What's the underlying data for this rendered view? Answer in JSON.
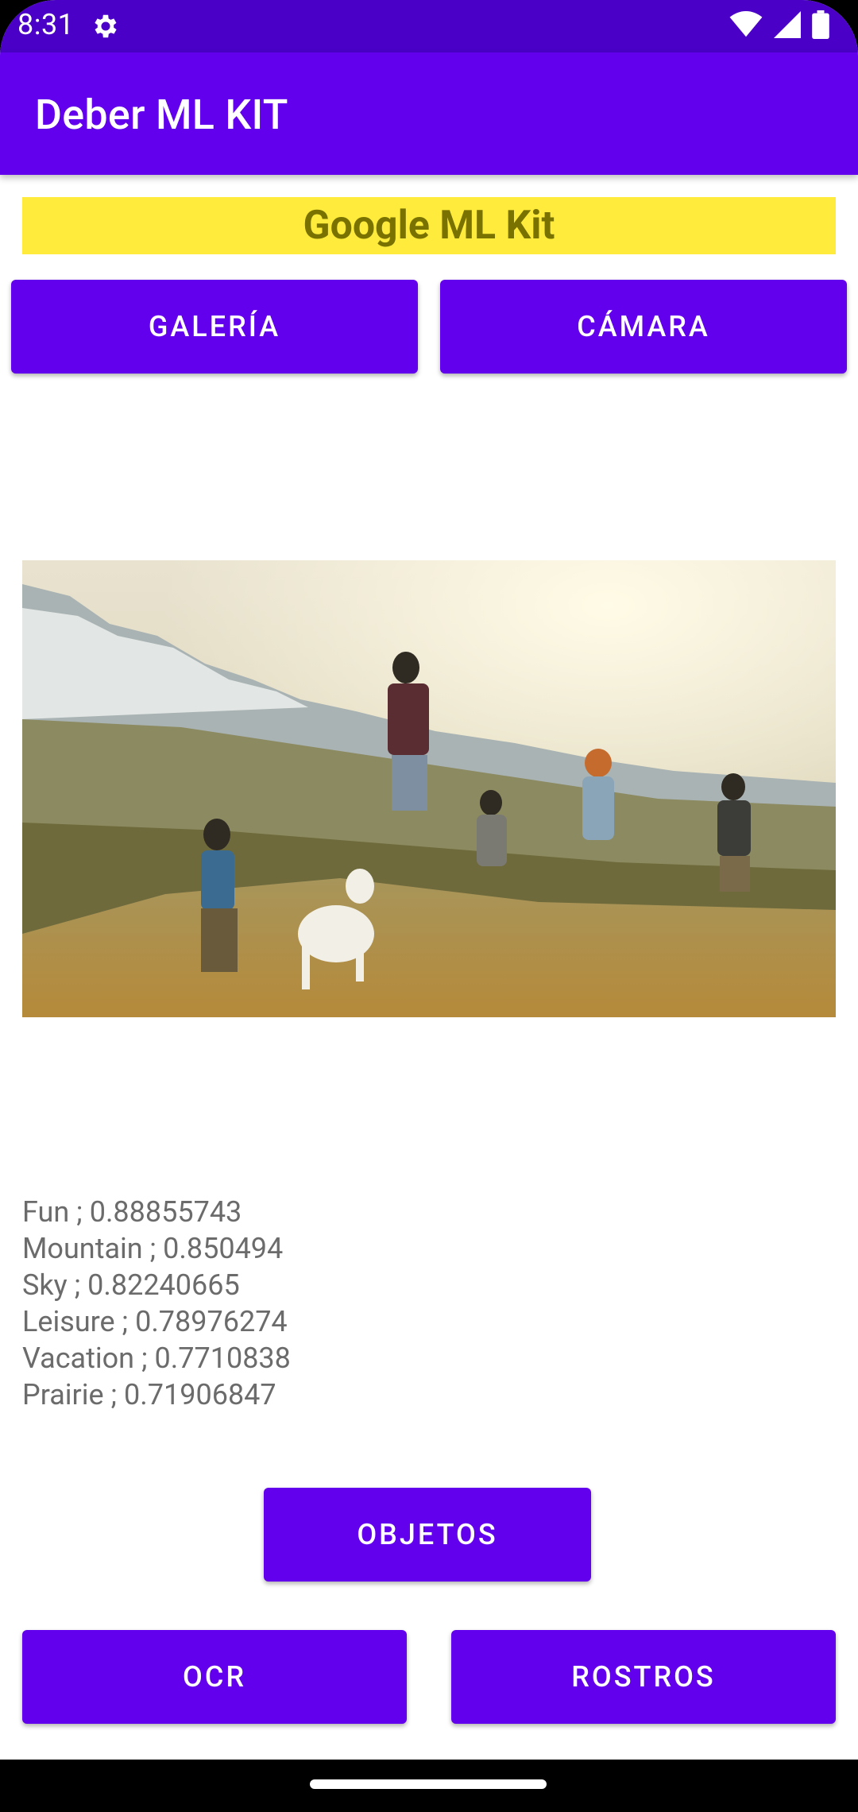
{
  "status_bar": {
    "time": "8:31",
    "icons": [
      "settings-gear-icon",
      "wifi-icon",
      "cell-signal-icon",
      "battery-icon"
    ],
    "background": "#4a00c7"
  },
  "app_bar": {
    "title": "Deber ML KIT",
    "background": "#6200ee"
  },
  "banner": {
    "text": "Google ML Kit",
    "background": "#ffeb3b"
  },
  "buttons": {
    "gallery": "GALERÍA",
    "camera": "CÁMARA",
    "objects": "OBJETOS",
    "ocr": "OCR",
    "faces": "ROSTROS"
  },
  "results": [
    "Fun ; 0.88855743",
    "Mountain ; 0.850494",
    "Sky ; 0.82240665",
    "Leisure ; 0.78976274",
    "Vacation ; 0.7710838",
    "Prairie ; 0.71906847"
  ],
  "colors": {
    "accent": "#6200ee",
    "result_text": "#6b6b6b"
  }
}
